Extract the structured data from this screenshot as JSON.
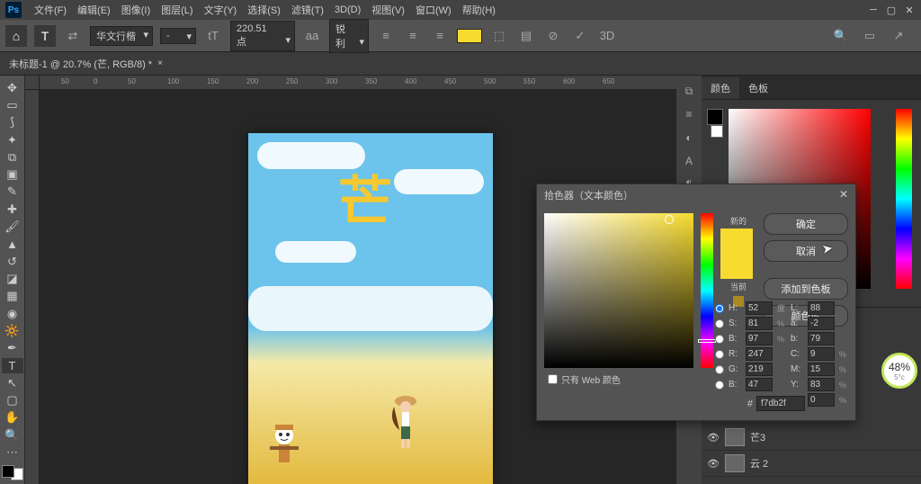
{
  "menubar": {
    "items": [
      "文件(F)",
      "编辑(E)",
      "图像(I)",
      "图层(L)",
      "文字(Y)",
      "选择(S)",
      "滤镜(T)",
      "3D(D)",
      "视图(V)",
      "窗口(W)",
      "帮助(H)"
    ]
  },
  "options": {
    "font_family": "华文行楷",
    "font_style": "-",
    "font_size": "220.51 点",
    "aa_label": "aa",
    "aa_mode": "锐利",
    "text_color": "#f7db2f",
    "threeD": "3D"
  },
  "tab": {
    "title": "未标题-1 @ 20.7% (芒, RGB/8) *"
  },
  "ruler_marks": [
    "50",
    "0",
    "50",
    "100",
    "150",
    "200",
    "250",
    "300",
    "350",
    "400",
    "450",
    "500",
    "550",
    "600",
    "650"
  ],
  "color_panel": {
    "tabs": [
      "颜色",
      "色板"
    ]
  },
  "color_picker": {
    "title": "拾色器（文本颜色）",
    "btn_ok": "确定",
    "btn_cancel": "取消",
    "btn_add": "添加到色板",
    "btn_lib": "颜色库",
    "label_new": "新的",
    "label_current": "当前",
    "web_only": "只有 Web 颜色",
    "fields": {
      "H": "52",
      "H_unit": "度",
      "L": "88",
      "S": "81",
      "S_unit": "%",
      "a": "-2",
      "B": "97",
      "B_unit": "%",
      "b": "79",
      "R": "247",
      "C": "9",
      "C_unit": "%",
      "G": "219",
      "M": "15",
      "M_unit": "%",
      "Bl": "47",
      "Y": "83",
      "Y_unit": "%",
      "K": "0",
      "K_unit": "%"
    },
    "hex": "f7db2f",
    "hex_prefix": "#"
  },
  "layers": {
    "items": [
      "芒3",
      "云 2"
    ]
  },
  "badge": {
    "percent": "48%",
    "sub": "5°c"
  },
  "glyph": "芒"
}
